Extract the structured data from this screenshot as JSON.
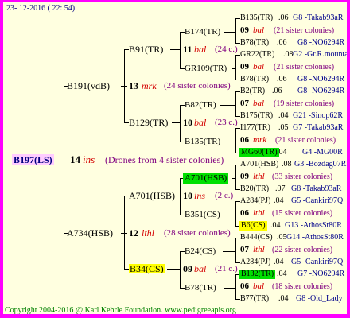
{
  "date": "23- 12-2016 ( 22: 54)",
  "copyright": "Copyright 2004-2016 @ Karl Kehrle Foundation.   www.pedigreeapis.org",
  "root": {
    "name": "B197(LS)",
    "gen": "14",
    "sp": "ins",
    "note": "(Drones from 4 sister colonies)"
  },
  "gen1": [
    {
      "name": "B191(vdB)",
      "gen": "13",
      "sp": "mrk",
      "note": "(24 sister colonies)"
    },
    {
      "name": "A734(HSB)",
      "gen": "12",
      "sp": "lthl",
      "note": "(28 sister colonies)"
    }
  ],
  "gen2": [
    {
      "name": "B91(TR)",
      "gen": "11",
      "sp": "bal",
      "note": "(24 c.)"
    },
    {
      "name": "B129(TR)",
      "gen": "10",
      "sp": "bal",
      "note": "(23 c.)"
    },
    {
      "name": "A701(HSB)",
      "gen": "10",
      "sp": "ins",
      "note": "(2 c.)"
    },
    {
      "name": "B34(CS)",
      "gen": "09",
      "sp": "bal",
      "note": "(21 c.)"
    }
  ],
  "gen3": [
    "B174(TR)",
    "GR109(TR)",
    "B82(TR)",
    "B135(TR)",
    "A701(HSB)",
    "B351(CS)",
    "B24(CS)",
    "B78(TR)"
  ],
  "gen4": [
    {
      "l1a": "B135(TR)",
      "l1b": ".06",
      "l1c": "G8 -Takab93aR",
      "g": "09",
      "sp": "bal",
      "n": "(21 sister colonies)",
      "l3a": "B78(TR)",
      "l3b": ".06",
      "l3c": "G8 -NO6294R"
    },
    {
      "l1a": "GR22(TR)",
      "l1b": ".08",
      "l1c": "G2 -Gr.R.mounta",
      "g": "09",
      "sp": "bal",
      "n": "(21 sister colonies)",
      "l3a": "B78(TR)",
      "l3b": ".06",
      "l3c": "G8 -NO6294R"
    },
    {
      "l1a": "B2(TR)",
      "l1b": ".06",
      "l1c": "G8 -NO6294R",
      "g": "07",
      "sp": "bal",
      "n": "(19 sister colonies)",
      "l3a": "B175(TR)",
      "l3b": ".04",
      "l3c": "G21 -Sinop62R"
    },
    {
      "l1a": "I177(TR)",
      "l1b": ".05",
      "l1c": "G7 -Takab93aR",
      "g": "06",
      "sp": "mrk",
      "n": "(21 sister colonies)",
      "l3a": "MG60(TR)",
      "l3b": ".04",
      "l3c": "G4 -MG00R"
    },
    {
      "l1a": "A701(HSB)",
      "l1b": ".08",
      "l1c": "G3 -Bozdag07R",
      "g": "09",
      "sp": "lthl",
      "n": "(33 sister colonies)",
      "l3a": "B20(TR)",
      "l3b": ".07",
      "l3c": "G8 -Takab93aR"
    },
    {
      "l1a": "A284(PJ)",
      "l1b": ".04",
      "l1c": "G5 -Cankiri97Q",
      "g": "06",
      "sp": "lthl",
      "n": "(15 sister colonies)",
      "l3a": "B6(CS)",
      "l3b": ".04",
      "l3c": "G13 -AthosSt80R"
    },
    {
      "l1a": "B444(CS)",
      "l1b": ".05",
      "l1c": "G14 -AthosSt80R",
      "g": "07",
      "sp": "lthl",
      "n": "(22 sister colonies)",
      "l3a": "A284(PJ)",
      "l3b": ".04",
      "l3c": "G5 -Cankiri97Q"
    },
    {
      "l1a": "B132(TR)",
      "l1b": ".04",
      "l1c": "G7 -NO6294R",
      "g": "06",
      "sp": "bal",
      "n": "(18 sister colonies)",
      "l3a": "B77(TR)",
      "l3b": ".04",
      "l3c": "G8 -Old_Lady"
    }
  ]
}
